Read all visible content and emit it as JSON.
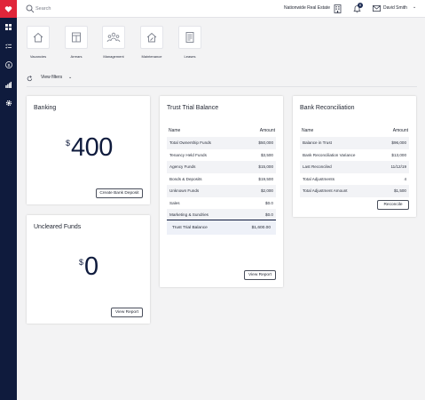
{
  "search": {
    "placeholder": "Search"
  },
  "header": {
    "company": "Nationwide Real Estate",
    "notification_count": "8",
    "user_name": "David Smith"
  },
  "quick_actions": [
    {
      "label": "Vacancies",
      "icon": "house-icon"
    },
    {
      "label": "Arrears",
      "icon": "ledger-icon"
    },
    {
      "label": "Management",
      "icon": "people-icon"
    },
    {
      "label": "Maintenance",
      "icon": "house-tools-icon"
    },
    {
      "label": "Leases",
      "icon": "document-icon"
    }
  ],
  "filters": {
    "label": "View filters"
  },
  "banking": {
    "title": "Banking",
    "currency": "$",
    "amount": "400",
    "button": "Create Bank Deposit"
  },
  "uncleared": {
    "title": "Uncleared Funds",
    "currency": "$",
    "amount": "0",
    "button": "View Report"
  },
  "trust": {
    "title": "Trust Trial Balance",
    "col_name": "Name",
    "col_amount": "Amount",
    "rows": [
      {
        "name": "Total Ownership Funds",
        "amount": "$50,000"
      },
      {
        "name": "Tenancy Held Funds",
        "amount": "$3,500"
      },
      {
        "name": "Agency Funds",
        "amount": "$15,000"
      },
      {
        "name": "Bonds & Deposits",
        "amount": "$19,500"
      },
      {
        "name": "Unknown Funds",
        "amount": "$2,000"
      },
      {
        "name": "Sales",
        "amount": "$0.0"
      },
      {
        "name": "Marketing & Sundries",
        "amount": "$0.0"
      }
    ],
    "total_label": "Trust Trial Balance",
    "total_amount": "$1,600.00",
    "button": "View Report"
  },
  "recon": {
    "title": "Bank Reconciliation",
    "col_name": "Name",
    "col_amount": "Amount",
    "rows": [
      {
        "name": "Balance in Trust",
        "amount": "$96,000"
      },
      {
        "name": "Bank Reconciliation Variance",
        "amount": "$13,000"
      },
      {
        "name": "Last Reconciled",
        "amount": "11/12/19"
      },
      {
        "name": "Total Adjustments",
        "amount": "4"
      },
      {
        "name": "Total Adjustment Amount",
        "amount": "$1,500"
      }
    ],
    "button": "Reconcile"
  },
  "colors": {
    "sidebar": "#0f1b3d",
    "brand": "#e0263a",
    "accent": "#0f1b3d"
  }
}
